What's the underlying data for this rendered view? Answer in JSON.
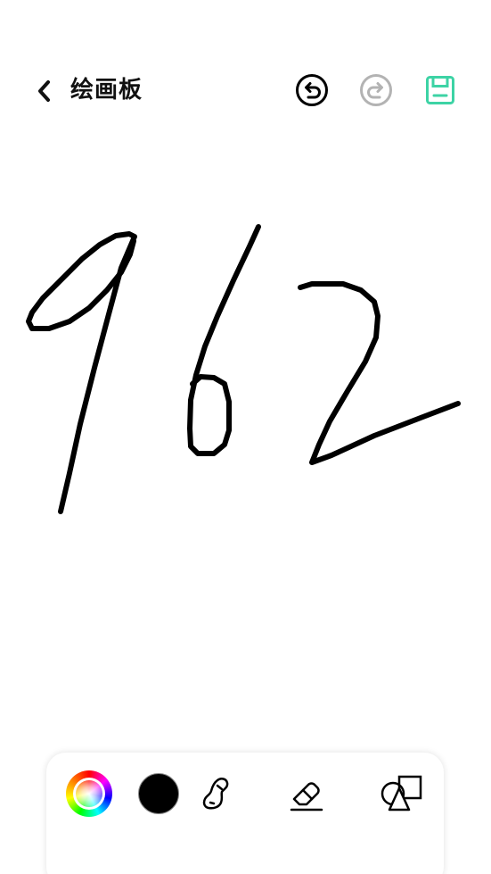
{
  "header": {
    "title": "绘画板",
    "back_icon": "chevron-left-icon",
    "undo_icon": "undo-icon",
    "redo_icon": "redo-icon",
    "save_icon": "save-icon"
  },
  "colors": {
    "ink": "#000000",
    "accent": "#3dd3a5",
    "disabled": "#b3b3b3",
    "selected_color": "#000000"
  },
  "toolbar": {
    "tools": [
      "color-wheel-icon",
      "color-swatch",
      "brush-icon",
      "eraser-icon",
      "shapes-icon"
    ]
  }
}
